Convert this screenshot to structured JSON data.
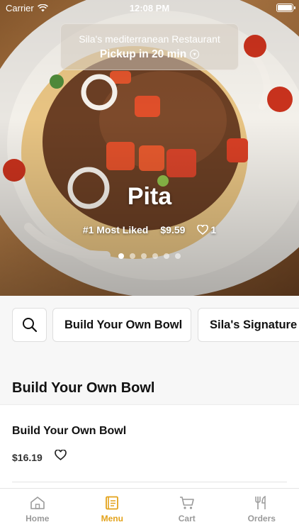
{
  "status_bar": {
    "carrier": "Carrier",
    "time": "12:08 PM"
  },
  "restaurant": {
    "name": "Sila's mediterranean Restaurant",
    "pickup": "Pickup in 20 min"
  },
  "hero": {
    "title": "Pita",
    "rank": "#1 Most Liked",
    "price": "$9.59",
    "likes": "1",
    "slide_count": 6,
    "active_slide": 0
  },
  "categories": {
    "items": [
      "Build Your Own Bowl",
      "Sila's Signature"
    ]
  },
  "section": {
    "title": "Build Your Own Bowl"
  },
  "menu_item": {
    "name": "Build Your Own Bowl",
    "price": "$16.19"
  },
  "tabs": [
    {
      "label": "Home",
      "icon": "home-icon",
      "active": false
    },
    {
      "label": "Menu",
      "icon": "menu-icon",
      "active": true
    },
    {
      "label": "Cart",
      "icon": "cart-icon",
      "active": false
    },
    {
      "label": "Orders",
      "icon": "orders-icon",
      "active": false
    }
  ],
  "colors": {
    "accent": "#e3a21a",
    "inactive": "#9a9a9a"
  }
}
